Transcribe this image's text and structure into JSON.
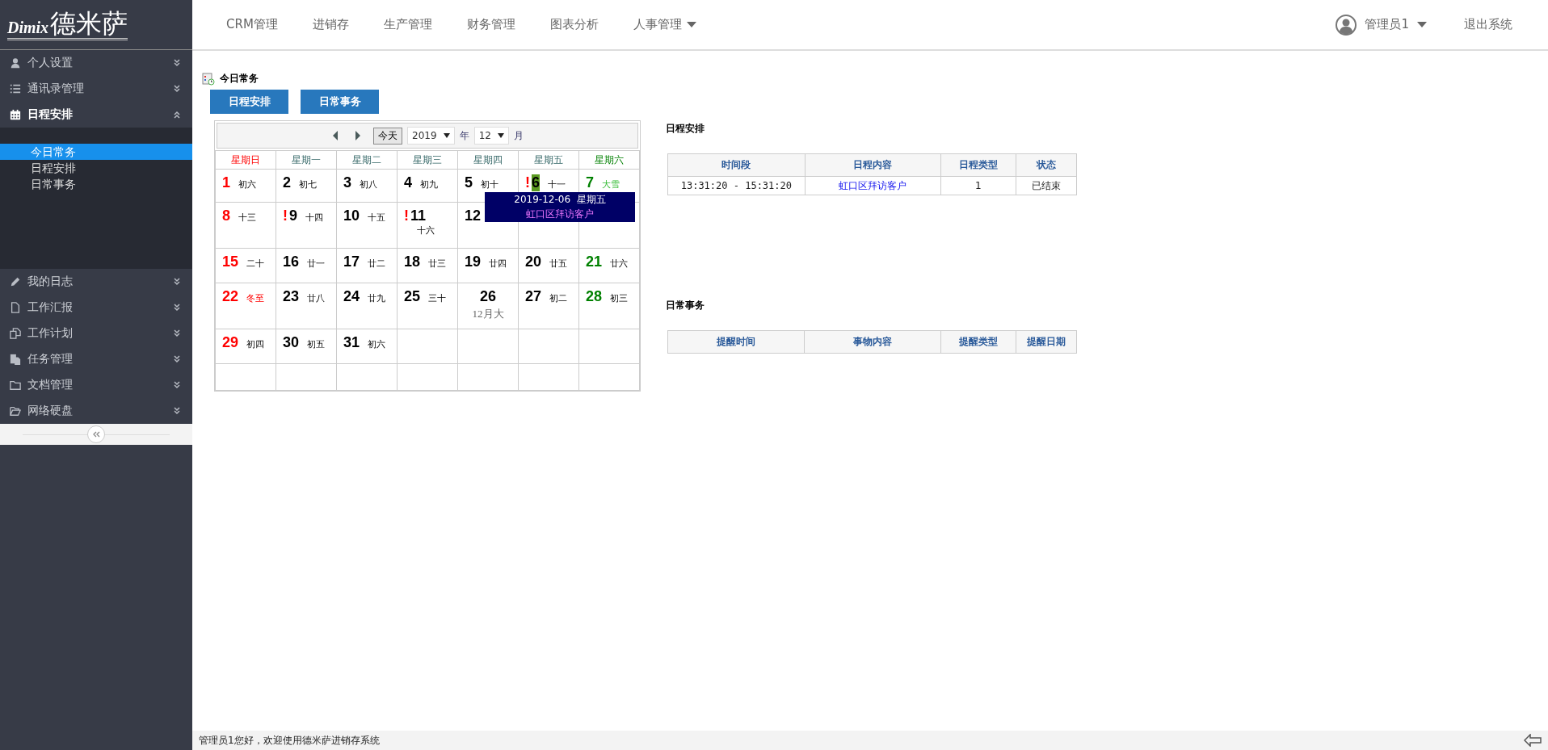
{
  "logo": {
    "latin": "Dimix",
    "name": "德米萨"
  },
  "top_nav": [
    {
      "label": "CRM管理",
      "dropdown": false
    },
    {
      "label": "进销存",
      "dropdown": false
    },
    {
      "label": "生产管理",
      "dropdown": false
    },
    {
      "label": "财务管理",
      "dropdown": false
    },
    {
      "label": "图表分析",
      "dropdown": false
    },
    {
      "label": "人事管理",
      "dropdown": true
    }
  ],
  "user": {
    "name": "管理员1",
    "logout": "退出系统"
  },
  "sidebar": {
    "items": [
      {
        "label": "个人设置",
        "expanded": false
      },
      {
        "label": "通讯录管理",
        "expanded": false
      },
      {
        "label": "日程安排",
        "expanded": true,
        "children": [
          {
            "label": "今日常务",
            "selected": true
          },
          {
            "label": "日程安排",
            "selected": false
          },
          {
            "label": "日常事务",
            "selected": false
          }
        ]
      },
      {
        "label": "我的日志",
        "expanded": false
      },
      {
        "label": "工作汇报",
        "expanded": false
      },
      {
        "label": "工作计划",
        "expanded": false
      },
      {
        "label": "任务管理",
        "expanded": false
      },
      {
        "label": "文档管理",
        "expanded": false
      },
      {
        "label": "网络硬盘",
        "expanded": false
      }
    ]
  },
  "page_title": "今日常务",
  "tab_buttons": [
    "日程安排",
    "日常事务"
  ],
  "calendar": {
    "today_button": "今天",
    "year": "2019",
    "year_unit": "年",
    "month": "12",
    "month_unit": "月",
    "weekdays": [
      "星期日",
      "星期一",
      "星期二",
      "星期三",
      "星期四",
      "星期五",
      "星期六"
    ],
    "weeks": [
      [
        {
          "day": "1",
          "lunar": "初六",
          "kind": "normal",
          "today": false
        },
        {
          "day": "2",
          "lunar": "初七",
          "kind": "normal",
          "today": false
        },
        {
          "day": "3",
          "lunar": "初八",
          "kind": "normal",
          "today": false
        },
        {
          "day": "4",
          "lunar": "初九",
          "kind": "normal",
          "today": false
        },
        {
          "day": "5",
          "lunar": "初十",
          "kind": "normal",
          "today": false
        },
        {
          "day": "6",
          "lunar": "十一",
          "kind": "normal",
          "flag": "!",
          "today": true
        },
        {
          "day": "7",
          "lunar": "大雪",
          "kind": "term",
          "today": false
        }
      ],
      [
        {
          "day": "8",
          "lunar": "十三",
          "kind": "normal",
          "today": false
        },
        {
          "day": "9",
          "lunar": "十四",
          "kind": "normal",
          "flag": "!",
          "today": false
        },
        {
          "day": "10",
          "lunar": "十五",
          "kind": "normal",
          "today": false
        },
        {
          "day": "11",
          "lunar": "十六",
          "kind": "wrap",
          "flag": "!",
          "today": false
        },
        {
          "day": "12",
          "kind": "normal",
          "today": false
        }
      ],
      [
        {
          "day": "15",
          "lunar": "二十",
          "kind": "normal",
          "today": false
        },
        {
          "day": "16",
          "lunar": "廿一",
          "kind": "normal",
          "today": false
        },
        {
          "day": "17",
          "lunar": "廿二",
          "kind": "normal",
          "today": false
        },
        {
          "day": "18",
          "lunar": "廿三",
          "kind": "normal",
          "today": false
        },
        {
          "day": "19",
          "lunar": "廿四",
          "kind": "normal",
          "today": false
        },
        {
          "day": "20",
          "lunar": "廿五",
          "kind": "normal",
          "today": false
        },
        {
          "day": "21",
          "lunar": "廿六",
          "kind": "normal",
          "today": false
        }
      ],
      [
        {
          "day": "22",
          "lunar": "冬至",
          "kind": "term",
          "today": false
        },
        {
          "day": "23",
          "lunar": "廿八",
          "kind": "normal",
          "today": false
        },
        {
          "day": "24",
          "lunar": "廿九",
          "kind": "normal",
          "today": false
        },
        {
          "day": "25",
          "lunar": "三十",
          "kind": "normal",
          "today": false
        },
        {
          "day": "26",
          "lunar": "12月大",
          "kind": "month",
          "today": false
        },
        {
          "day": "27",
          "lunar": "初二",
          "kind": "normal",
          "today": false
        },
        {
          "day": "28",
          "lunar": "初三",
          "kind": "normal",
          "today": false
        }
      ],
      [
        {
          "day": "29",
          "lunar": "初四",
          "kind": "normal",
          "today": false
        },
        {
          "day": "30",
          "lunar": "初五",
          "kind": "normal",
          "today": false
        },
        {
          "day": "31",
          "lunar": "初六",
          "kind": "normal",
          "today": false
        }
      ]
    ],
    "tooltip": {
      "date": "2019-12-06  星期五",
      "event": "虹口区拜访客户"
    }
  },
  "schedule": {
    "title": "日程安排",
    "columns": [
      "时间段",
      "日程内容",
      "日程类型",
      "状态"
    ],
    "rows": [
      {
        "time": "13:31:20 - 15:31:20",
        "content": "虹口区拜访客户",
        "type": "1",
        "status": "已结束"
      }
    ]
  },
  "affairs": {
    "title": "日常事务",
    "columns": [
      "提醒时间",
      "事物内容",
      "提醒类型",
      "提醒日期"
    ]
  },
  "status_bar": "管理员1您好，欢迎使用德米萨进销存系统"
}
